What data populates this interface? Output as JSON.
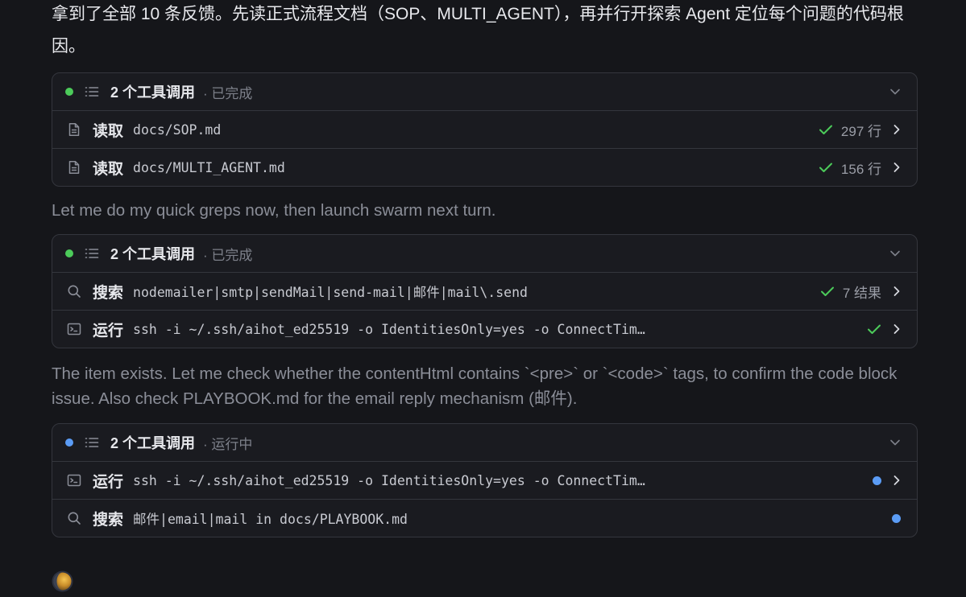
{
  "intro_text": "拿到了全部 10 条反馈。先读正式流程文档（SOP、MULTI_AGENT），再并行开探索 Agent 定位每个问题的代码根因。",
  "note1": "Let me do my quick greps now, then launch swarm next turn.",
  "note2": "The item exists. Let me check whether the contentHtml contains `<pre>` or `<code>` tags, to confirm the code block issue. Also check PLAYBOOK.md for the email reply mechanism (邮件).",
  "colors": {
    "done": "#4ccb5a",
    "running": "#5b9cf5",
    "background": "#15161a",
    "card": "#1a1b20",
    "border": "#34363d"
  },
  "groups": [
    {
      "title": "2 个工具调用",
      "status": "· 已完成",
      "state": "done",
      "rows": [
        {
          "icon": "document-icon",
          "verb": "读取",
          "arg": "docs/SOP.md",
          "meta": "297 行",
          "state": "done"
        },
        {
          "icon": "document-icon",
          "verb": "读取",
          "arg": "docs/MULTI_AGENT.md",
          "meta": "156 行",
          "state": "done"
        }
      ]
    },
    {
      "title": "2 个工具调用",
      "status": "· 已完成",
      "state": "done",
      "rows": [
        {
          "icon": "search-icon",
          "verb": "搜索",
          "arg": "nodemailer|smtp|sendMail|send-mail|邮件|mail\\.send",
          "meta": "7 结果",
          "state": "done"
        },
        {
          "icon": "terminal-icon",
          "verb": "运行",
          "arg": "ssh -i ~/.ssh/aihot_ed25519 -o IdentitiesOnly=yes -o ConnectTim…",
          "meta": "",
          "state": "done"
        }
      ]
    },
    {
      "title": "2 个工具调用",
      "status": "· 运行中",
      "state": "running",
      "rows": [
        {
          "icon": "terminal-icon",
          "verb": "运行",
          "arg": "ssh -i ~/.ssh/aihot_ed25519 -o IdentitiesOnly=yes -o ConnectTim…",
          "meta": "",
          "state": "running"
        },
        {
          "icon": "search-icon",
          "verb": "搜索",
          "arg": "邮件|email|mail in docs/PLAYBOOK.md",
          "meta": "",
          "state": "running"
        }
      ]
    }
  ]
}
